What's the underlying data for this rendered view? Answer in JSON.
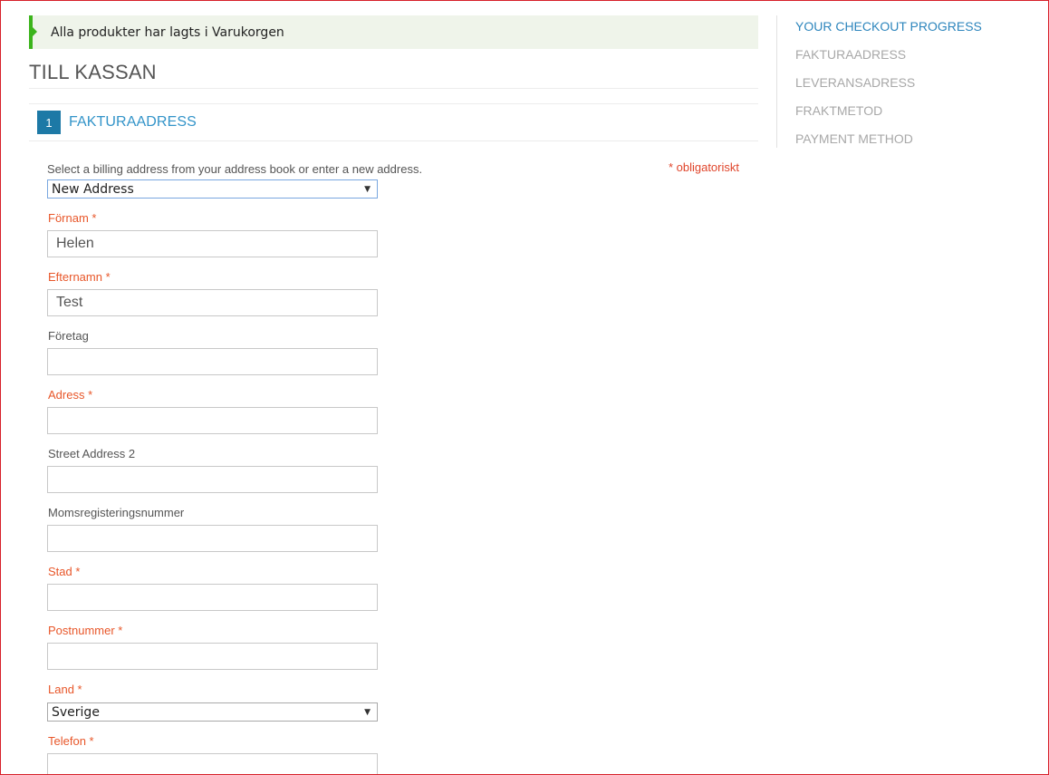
{
  "notice": {
    "text": "Alla produkter har lagts i Varukorgen"
  },
  "page": {
    "title": "TILL KASSAN"
  },
  "step": {
    "number": "1",
    "title": "FAKTURAADRESS"
  },
  "form": {
    "intro": "Select a billing address from your address book or enter a new address.",
    "required_note": "* obligatoriskt",
    "address_select": {
      "selected": "New Address"
    },
    "fields": {
      "firstname": {
        "label": "Förnam *",
        "value": "Helen"
      },
      "lastname": {
        "label": "Efternamn *",
        "value": "Test"
      },
      "company": {
        "label": "Företag",
        "value": ""
      },
      "street1": {
        "label": "Adress *",
        "value": ""
      },
      "street2": {
        "label": "Street Address 2",
        "value": ""
      },
      "vat": {
        "label": "Momsregisteringsnummer",
        "value": ""
      },
      "city": {
        "label": "Stad *",
        "value": ""
      },
      "postcode": {
        "label": "Postnummer *",
        "value": ""
      },
      "country": {
        "label": "Land *",
        "selected": "Sverige"
      },
      "telephone": {
        "label": "Telefon *",
        "value": ""
      }
    }
  },
  "sidebar": {
    "title": "YOUR CHECKOUT PROGRESS",
    "items": [
      {
        "label": "FAKTURAADRESS"
      },
      {
        "label": "LEVERANSADRESS"
      },
      {
        "label": "FRAKTMETOD"
      },
      {
        "label": "PAYMENT METHOD"
      }
    ]
  },
  "colors": {
    "accent_blue": "#1d79a6",
    "link_blue": "#3394c9",
    "required_orange": "#e8572a",
    "success_green": "#3cb41c",
    "notice_bg": "#eff4ea",
    "frame_red": "#d7202a"
  },
  "icons": {
    "notice": "success-marker-icon",
    "select": "dropdown-arrow-icon"
  }
}
